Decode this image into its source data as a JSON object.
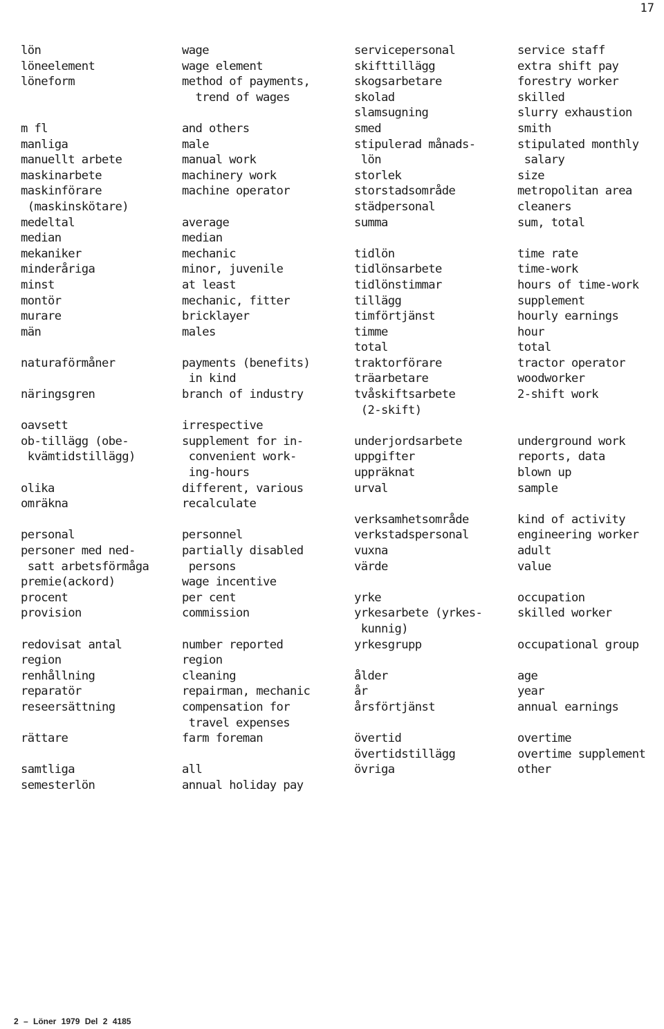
{
  "page_number": "17",
  "left_column": [
    {
      "sv": "lön",
      "en": "wage"
    },
    {
      "sv": "löneelement",
      "en": "wage element"
    },
    {
      "sv": "löneform",
      "en": "method of payments,"
    },
    {
      "sv": "",
      "en": "  trend of wages"
    },
    {
      "sv": "",
      "en": ""
    },
    {
      "sv": "m fl",
      "en": "and others"
    },
    {
      "sv": "manliga",
      "en": "male"
    },
    {
      "sv": "manuellt arbete",
      "en": "manual work"
    },
    {
      "sv": "maskinarbete",
      "en": "machinery work"
    },
    {
      "sv": "maskinförare",
      "en": "machine operator"
    },
    {
      "sv": " (maskinskötare)",
      "en": ""
    },
    {
      "sv": "medeltal",
      "en": "average"
    },
    {
      "sv": "median",
      "en": "median"
    },
    {
      "sv": "mekaniker",
      "en": "mechanic"
    },
    {
      "sv": "minderåriga",
      "en": "minor, juvenile"
    },
    {
      "sv": "minst",
      "en": "at least"
    },
    {
      "sv": "montör",
      "en": "mechanic, fitter"
    },
    {
      "sv": "murare",
      "en": "bricklayer"
    },
    {
      "sv": "män",
      "en": "males"
    },
    {
      "sv": "",
      "en": ""
    },
    {
      "sv": "naturaförmåner",
      "en": "payments (benefits)"
    },
    {
      "sv": "",
      "en": " in kind"
    },
    {
      "sv": "näringsgren",
      "en": "branch of industry"
    },
    {
      "sv": "",
      "en": ""
    },
    {
      "sv": "oavsett",
      "en": "irrespective"
    },
    {
      "sv": "ob-tillägg (obe-",
      "en": "supplement for in-"
    },
    {
      "sv": " kvämtidstillägg)",
      "en": " convenient work-"
    },
    {
      "sv": "",
      "en": " ing-hours"
    },
    {
      "sv": "olika",
      "en": "different, various"
    },
    {
      "sv": "omräkna",
      "en": "recalculate"
    },
    {
      "sv": "",
      "en": ""
    },
    {
      "sv": "personal",
      "en": "personnel"
    },
    {
      "sv": "personer med ned-",
      "en": "partially disabled"
    },
    {
      "sv": " satt arbetsförmåga",
      "en": " persons"
    },
    {
      "sv": "premie(ackord)",
      "en": "wage incentive"
    },
    {
      "sv": "procent",
      "en": "per cent"
    },
    {
      "sv": "provision",
      "en": "commission"
    },
    {
      "sv": "",
      "en": ""
    },
    {
      "sv": "redovisat antal",
      "en": "number reported"
    },
    {
      "sv": "region",
      "en": "region"
    },
    {
      "sv": "renhållning",
      "en": "cleaning"
    },
    {
      "sv": "reparatör",
      "en": "repairman, mechanic"
    },
    {
      "sv": "reseersättning",
      "en": "compensation for"
    },
    {
      "sv": "",
      "en": " travel expenses"
    },
    {
      "sv": "rättare",
      "en": "farm foreman"
    },
    {
      "sv": "",
      "en": ""
    },
    {
      "sv": "samtliga",
      "en": "all"
    },
    {
      "sv": "semesterlön",
      "en": "annual holiday pay"
    }
  ],
  "right_column": [
    {
      "sv": "servicepersonal",
      "en": "service staff"
    },
    {
      "sv": "skifttillägg",
      "en": "extra shift pay"
    },
    {
      "sv": "skogsarbetare",
      "en": "forestry worker"
    },
    {
      "sv": "skolad",
      "en": "skilled"
    },
    {
      "sv": "slamsugning",
      "en": "slurry exhaustion"
    },
    {
      "sv": "smed",
      "en": "smith"
    },
    {
      "sv": "stipulerad månads-",
      "en": "stipulated monthly"
    },
    {
      "sv": " lön",
      "en": " salary"
    },
    {
      "sv": "storlek",
      "en": "size"
    },
    {
      "sv": "storstadsområde",
      "en": "metropolitan area"
    },
    {
      "sv": "städpersonal",
      "en": "cleaners"
    },
    {
      "sv": "summa",
      "en": "sum, total"
    },
    {
      "sv": "",
      "en": ""
    },
    {
      "sv": "tidlön",
      "en": "time rate"
    },
    {
      "sv": "tidlönsarbete",
      "en": "time-work"
    },
    {
      "sv": "tidlönstimmar",
      "en": "hours of time-work"
    },
    {
      "sv": "tillägg",
      "en": "supplement"
    },
    {
      "sv": "timförtjänst",
      "en": "hourly earnings"
    },
    {
      "sv": "timme",
      "en": "hour"
    },
    {
      "sv": "total",
      "en": "total"
    },
    {
      "sv": "traktorförare",
      "en": "tractor operator"
    },
    {
      "sv": "träarbetare",
      "en": "woodworker"
    },
    {
      "sv": "tvåskiftsarbete",
      "en": "2-shift work"
    },
    {
      "sv": " (2-skift)",
      "en": ""
    },
    {
      "sv": "",
      "en": ""
    },
    {
      "sv": "underjordsarbete",
      "en": "underground work"
    },
    {
      "sv": "uppgifter",
      "en": "reports, data"
    },
    {
      "sv": "uppräknat",
      "en": "blown up"
    },
    {
      "sv": "urval",
      "en": "sample"
    },
    {
      "sv": "",
      "en": ""
    },
    {
      "sv": "verksamhetsområde",
      "en": "kind of activity"
    },
    {
      "sv": "verkstadspersonal",
      "en": "engineering worker"
    },
    {
      "sv": "vuxna",
      "en": "adult"
    },
    {
      "sv": "värde",
      "en": "value"
    },
    {
      "sv": "",
      "en": ""
    },
    {
      "sv": "yrke",
      "en": "occupation"
    },
    {
      "sv": "yrkesarbete (yrkes-",
      "en": "skilled worker"
    },
    {
      "sv": " kunnig)",
      "en": ""
    },
    {
      "sv": "yrkesgrupp",
      "en": "occupational group"
    },
    {
      "sv": "",
      "en": ""
    },
    {
      "sv": "ålder",
      "en": "age"
    },
    {
      "sv": "år",
      "en": "year"
    },
    {
      "sv": "årsförtjänst",
      "en": "annual earnings"
    },
    {
      "sv": "",
      "en": ""
    },
    {
      "sv": "övertid",
      "en": "overtime"
    },
    {
      "sv": "övertidstillägg",
      "en": "overtime supplement"
    },
    {
      "sv": "övriga",
      "en": "other"
    }
  ],
  "footer": "2 – Löner 1979   Del 2   4185"
}
